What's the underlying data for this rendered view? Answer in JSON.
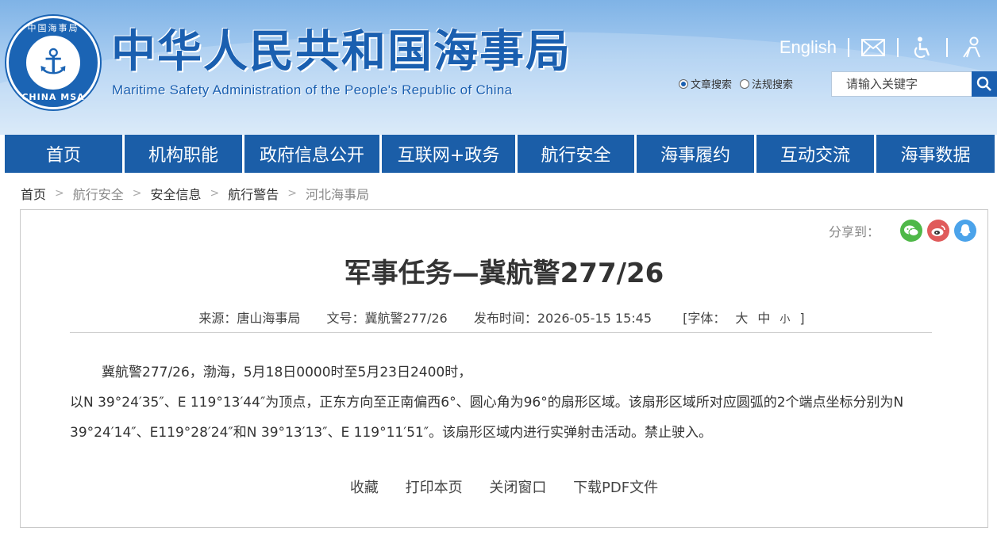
{
  "header": {
    "emblem_top": "中国海事局",
    "emblem_bottom": "CHINA MSA",
    "title_cn": "中华人民共和国海事局",
    "title_en": "Maritime Safety Administration of the People's Republic of China",
    "language_link": "English",
    "icons": [
      "mail-icon",
      "accessibility-icon",
      "elderly-mode-icon"
    ]
  },
  "search": {
    "option_articles": "文章搜索",
    "option_laws": "法规搜索",
    "selected": "文章搜索",
    "placeholder": "请输入关键字"
  },
  "nav": {
    "items": [
      "首页",
      "机构职能",
      "政府信息公开",
      "互联网+政务",
      "航行安全",
      "海事履约",
      "互动交流",
      "海事数据"
    ]
  },
  "breadcrumb": [
    "首页",
    "航行安全",
    "安全信息",
    "航行警告",
    "河北海事局"
  ],
  "share": {
    "label": "分享到：",
    "icons": [
      "wechat-icon",
      "weibo-icon",
      "qq-icon"
    ]
  },
  "article": {
    "title": "军事任务—冀航警277/26",
    "source": "来源：唐山海事局",
    "doc_no": "文号：冀航警277/26",
    "published": "发布时间：2026-05-15 15:45",
    "font_label": "[字体：",
    "font_large": "大",
    "font_medium": "中",
    "font_small": "小",
    "font_close": "]",
    "para1": "冀航警277/26，渤海，5月18日0000时至5月23日2400时，",
    "para2": "以N 39°24′35″、E 119°13′44″为顶点，正东方向至正南偏西6°、圆心角为96°的扇形区域。该扇形区域所对应圆弧的2个端点坐标分别为N 39°24′14″、E119°28′24″和N 39°13′13″、E 119°11′51″。该扇形区域内进行实弹射击活动。禁止驶入。"
  },
  "actions": [
    "收藏",
    "打印本页",
    "关闭窗口",
    "下载PDF文件"
  ],
  "colors": {
    "brand_blue": "#1b5ea8",
    "title_blue": "#1a5fb0"
  }
}
